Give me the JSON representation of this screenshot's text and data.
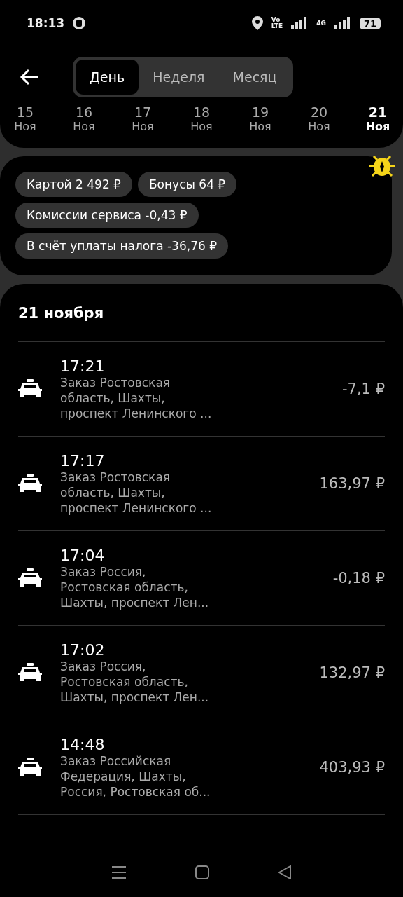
{
  "status_bar": {
    "time": "18:13",
    "volte_top": "Vo",
    "volte_bottom": "LTE",
    "network": "4G",
    "battery": "71"
  },
  "tabs": [
    {
      "label": "День",
      "selected": true
    },
    {
      "label": "Неделя",
      "selected": false
    },
    {
      "label": "Месяц",
      "selected": false
    }
  ],
  "dates": [
    {
      "day": "15",
      "month": "Ноя",
      "selected": false
    },
    {
      "day": "16",
      "month": "Ноя",
      "selected": false
    },
    {
      "day": "17",
      "month": "Ноя",
      "selected": false
    },
    {
      "day": "18",
      "month": "Ноя",
      "selected": false
    },
    {
      "day": "19",
      "month": "Ноя",
      "selected": false
    },
    {
      "day": "20",
      "month": "Ноя",
      "selected": false
    },
    {
      "day": "21",
      "month": "Ноя",
      "selected": true
    }
  ],
  "summary_chips": [
    "Картой 2 492 ₽",
    "Бонусы 64 ₽",
    "Комиссии сервиса -0,43 ₽",
    "В счёт уплаты налога -36,76 ₽"
  ],
  "list": {
    "date_heading": "21 ноября",
    "orders": [
      {
        "time": "17:21",
        "address": "Заказ Ростовская область, Шахты, проспект Ленинского ...",
        "amount": "-7,1 ₽"
      },
      {
        "time": "17:17",
        "address": "Заказ Ростовская область, Шахты, проспект Ленинского ...",
        "amount": "163,97 ₽"
      },
      {
        "time": "17:04",
        "address": "Заказ Россия, Ростовская область, Шахты, проспект Лен...",
        "amount": "-0,18 ₽"
      },
      {
        "time": "17:02",
        "address": "Заказ Россия, Ростовская область, Шахты, проспект Лен...",
        "amount": "132,97 ₽"
      },
      {
        "time": "14:48",
        "address": "Заказ Российская Федерация, Шахты, Россия, Ростовская об...",
        "amount": "403,93 ₽"
      }
    ]
  }
}
